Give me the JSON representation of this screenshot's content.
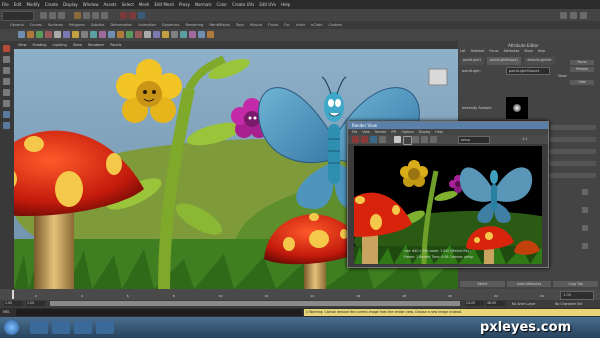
{
  "menubar": {
    "items": [
      "File",
      "Edit",
      "Modify",
      "Create",
      "Display",
      "Window",
      "Assets",
      "Select",
      "Mesh",
      "Edit Mesh",
      "Proxy",
      "Normals",
      "Color",
      "Create UVs",
      "Edit UVs",
      "Help"
    ]
  },
  "shelf_tabs": [
    "General",
    "Curves",
    "Surfaces",
    "Polygons",
    "Subdivs",
    "Deformation",
    "Animation",
    "Dynamics",
    "Rendering",
    "PaintEffects",
    "Toon",
    "Muscle",
    "Fluids",
    "Fur",
    "nHair",
    "nCloth",
    "Custom"
  ],
  "panel_menu": [
    "View",
    "Shading",
    "Lighting",
    "Show",
    "Renderer",
    "Panels"
  ],
  "attribute_editor": {
    "title": "Attribute Editor",
    "tabs": [
      "List",
      "Selected",
      "Focus",
      "Attributes",
      "Show",
      "Help"
    ],
    "node_tabs": [
      "pointLight1",
      "pointLightShape1",
      "defaultLightSet"
    ],
    "field_label": "pointLight:",
    "field_value": "pointLightShape1",
    "focus_btn": "Focus",
    "presets_btn": "Presets",
    "show_btn": "Show",
    "hide_btn": "Hide",
    "sample_label": "Intensity Sample",
    "bottom_buttons": [
      "Select",
      "Load Attributes",
      "Copy Tab"
    ]
  },
  "channel_box": {
    "title": "Channel Box / Layer Editor"
  },
  "render_view": {
    "title": "Render View",
    "menu": [
      "File",
      "View",
      "Render",
      "IPR",
      "Options",
      "Display",
      "Help"
    ],
    "camera": "persp",
    "zoom": "1:1",
    "info_line1": "size: 640 x 360  zoom: 1.000   (Mental Ray)",
    "info_line2": "Frame: 1    Render Time: 0:08    Camera: persp"
  },
  "timeline": {
    "ticks": [
      "1",
      "2",
      "4",
      "6",
      "8",
      "10",
      "12",
      "14",
      "16",
      "18",
      "20",
      "22",
      "24"
    ],
    "current_frame": "1.00"
  },
  "range": {
    "start": "1.00",
    "start2": "1.00",
    "end": "24.00",
    "end2": "48.00",
    "anim_layer": "No Anim Layer",
    "char_set": "No Character Set"
  },
  "command_line": {
    "label": "MEL",
    "warning": "// Warning: Cannot remove the current image from the render view. Choose a new image instead."
  },
  "watermark": "pxleyes.com",
  "colors": {
    "accent": "#5a7fa8",
    "warning_bg": "#e8d57a",
    "sky": "#7fa4c2",
    "grass": "#3f7f22"
  }
}
